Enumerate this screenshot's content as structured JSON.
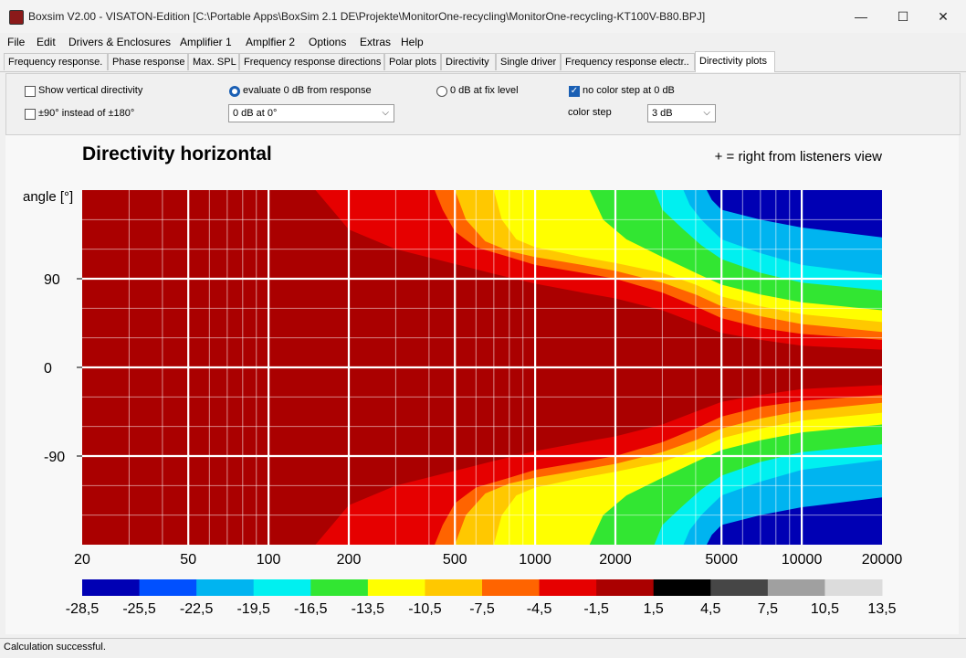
{
  "window": {
    "title": "Boxsim V2.00 - VISATON-Edition [C:\\Portable Apps\\BoxSim 2.1 DE\\Projekte\\MonitorOne-recycling\\MonitorOne-recycling-KT100V-B80.BPJ]",
    "minimize": "—",
    "maximize": "☐",
    "close": "✕"
  },
  "menu": [
    "File",
    "Edit",
    "Drivers & Enclosures",
    "Amplifier 1",
    "Amplfier 2",
    "Options",
    "Extras",
    "Help"
  ],
  "tabs": [
    {
      "label": "Frequency response.",
      "active": false
    },
    {
      "label": "Phase response",
      "active": false
    },
    {
      "label": "Max. SPL",
      "active": false
    },
    {
      "label": "Frequency response directions",
      "active": false
    },
    {
      "label": "Polar plots",
      "active": false
    },
    {
      "label": "Directivity",
      "active": false
    },
    {
      "label": "Single driver",
      "active": false
    },
    {
      "label": "Frequency response electr..",
      "active": false
    },
    {
      "label": "Directivity plots",
      "active": true
    }
  ],
  "options": {
    "show_vertical": {
      "label": "Show vertical directivity",
      "checked": false
    },
    "pm90": {
      "label": "±90° instead of ±180°",
      "checked": false
    },
    "evaluate_radio": {
      "label": "evaluate 0 dB from response",
      "selected": true
    },
    "evaluate_combo": "0 dB at 0°",
    "fix_level_radio": {
      "label": "0 dB at fix level",
      "selected": false
    },
    "no_color_step": {
      "label": "no color step at 0 dB",
      "checked": true
    },
    "color_step_label": "color step",
    "color_step_value": "3 dB"
  },
  "plot": {
    "title": "Directivity horizontal",
    "note": "+ = right from listeners view",
    "ylabel": "angle [°]"
  },
  "chart_data": {
    "type": "heatmap",
    "title": "Directivity horizontal",
    "ylabel": "angle [°]",
    "x_scale": "log",
    "xlim": [
      20,
      20000
    ],
    "ylim": [
      -180,
      180
    ],
    "x_ticks": [
      20,
      50,
      100,
      200,
      500,
      1000,
      2000,
      5000,
      10000,
      20000
    ],
    "x_tick_labels": [
      "20",
      "50",
      "100",
      "200",
      "500",
      "1000",
      "2000",
      "5000",
      "10000",
      "20000"
    ],
    "y_ticks": [
      90,
      0,
      -90
    ],
    "y_tick_labels": [
      "90",
      "0",
      "-90"
    ],
    "colorbar": {
      "boundaries": [
        "-28,5",
        "-25,5",
        "-22,5",
        "-19,5",
        "-16,5",
        "-13,5",
        "-10,5",
        "-7,5",
        "-4,5",
        "-1,5",
        "1,5",
        "4,5",
        "7,5",
        "10,5",
        "13,5"
      ],
      "colors": [
        "#0000b4",
        "#0050ff",
        "#00b4f0",
        "#00f0f0",
        "#32e632",
        "#ffff00",
        "#ffc800",
        "#ff6400",
        "#e60000",
        "#aa0000",
        "#000000",
        "#464646",
        "#a0a0a0",
        "#dcdcdc"
      ]
    },
    "contours": [
      {
        "level": "-1,5",
        "color": "#e60000",
        "x": [
          20,
          150,
          200,
          300,
          500,
          700,
          1000,
          1500,
          2000,
          3000,
          4000,
          5000,
          7000,
          10000,
          20000
        ],
        "y": [
          180,
          180,
          140,
          120,
          105,
          95,
          85,
          76,
          70,
          58,
          45,
          35,
          28,
          22,
          18
        ]
      },
      {
        "level": "-4,5",
        "color": "#ff6400",
        "x": [
          20,
          420,
          450,
          500,
          600,
          800,
          1000,
          1500,
          2000,
          3000,
          4000,
          5000,
          7000,
          10000,
          20000
        ],
        "y": [
          180,
          180,
          160,
          138,
          122,
          112,
          104,
          96,
          90,
          76,
          62,
          50,
          40,
          34,
          28
        ]
      },
      {
        "level": "-7,5",
        "color": "#ffc800",
        "x": [
          20,
          500,
          550,
          650,
          800,
          1000,
          1500,
          2000,
          3000,
          4000,
          5000,
          7000,
          10000,
          20000
        ],
        "y": [
          180,
          180,
          150,
          128,
          118,
          112,
          104,
          98,
          86,
          74,
          62,
          52,
          44,
          36
        ]
      },
      {
        "level": "-10,5",
        "color": "#ffff00",
        "x": [
          20,
          700,
          750,
          850,
          1000,
          1500,
          2000,
          3000,
          4000,
          5000,
          7000,
          10000,
          20000
        ],
        "y": [
          180,
          180,
          150,
          130,
          122,
          112,
          106,
          96,
          84,
          72,
          62,
          54,
          46
        ]
      },
      {
        "level": "-13,5",
        "color": "#32e632",
        "x": [
          20,
          1600,
          1800,
          2200,
          3000,
          4000,
          5000,
          7000,
          10000,
          20000
        ],
        "y": [
          180,
          180,
          150,
          130,
          112,
          96,
          84,
          74,
          66,
          58
        ]
      },
      {
        "level": "-19,5",
        "color": "#00f0f0",
        "x": [
          20,
          2800,
          3000,
          3600,
          4200,
          5000,
          7000,
          10000,
          20000
        ],
        "y": [
          180,
          180,
          160,
          140,
          124,
          110,
          96,
          86,
          78
        ]
      },
      {
        "level": "-22,5",
        "color": "#00b4f0",
        "x": [
          20,
          3600,
          3800,
          4200,
          4500,
          5000,
          7000,
          10000,
          20000
        ],
        "y": [
          180,
          180,
          165,
          150,
          142,
          130,
          116,
          104,
          94
        ]
      },
      {
        "level": "-25,5",
        "color": "#0000b4",
        "x": [
          20,
          4400,
          4600,
          5000,
          7000,
          10000,
          20000
        ],
        "y": [
          180,
          180,
          170,
          160,
          150,
          142,
          132
        ]
      }
    ]
  },
  "status": "Calculation successful."
}
